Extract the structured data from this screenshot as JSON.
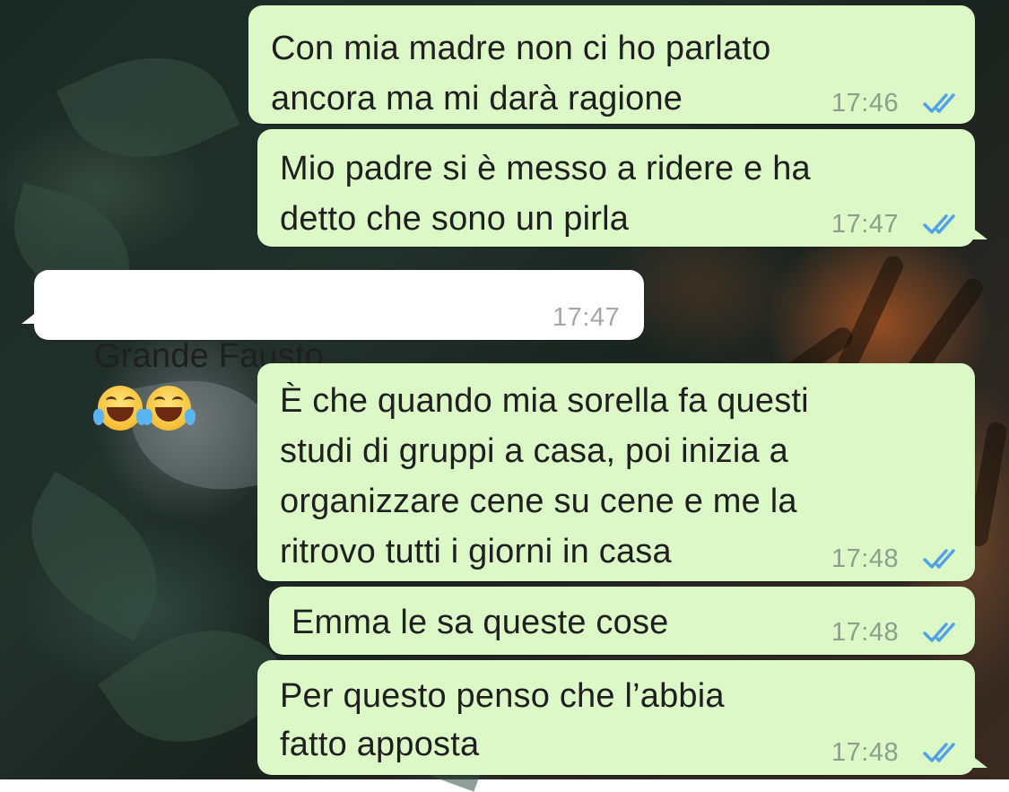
{
  "messages": [
    {
      "direction": "outgoing",
      "lines": [
        "Con mia madre non ci ho parlato",
        "ancora ma mi darà ragione"
      ],
      "time": "17:46",
      "status": "read"
    },
    {
      "direction": "outgoing",
      "lines": [
        "Mio padre si è messo a ridere e ha",
        "detto che sono un pirla"
      ],
      "time": "17:47",
      "status": "read"
    },
    {
      "direction": "incoming",
      "lines": [
        "Grande Fausto"
      ],
      "emoji": [
        "face-with-tears-of-joy",
        "face-with-tears-of-joy"
      ],
      "time": "17:47"
    },
    {
      "direction": "outgoing",
      "lines": [
        "È che quando mia sorella fa questi",
        "studi di gruppi a casa, poi inizia a",
        "organizzare cene su cene e me la",
        "ritrovo tutti i giorni in casa"
      ],
      "time": "17:48",
      "status": "read"
    },
    {
      "direction": "outgoing",
      "lines": [
        "Emma le sa queste cose"
      ],
      "time": "17:48",
      "status": "read"
    },
    {
      "direction": "outgoing",
      "lines": [
        "Per questo penso che l’abbia",
        "fatto apposta"
      ],
      "time": "17:48",
      "status": "read"
    }
  ],
  "colors": {
    "outgoing_bubble": "#dcf8c6",
    "incoming_bubble": "#ffffff",
    "read_ticks": "#4fa3e6",
    "timestamp": "#8e9e8e"
  },
  "icons": {
    "read_receipt": "double-check-icon",
    "emoji": "face-with-tears-of-joy-emoji"
  }
}
